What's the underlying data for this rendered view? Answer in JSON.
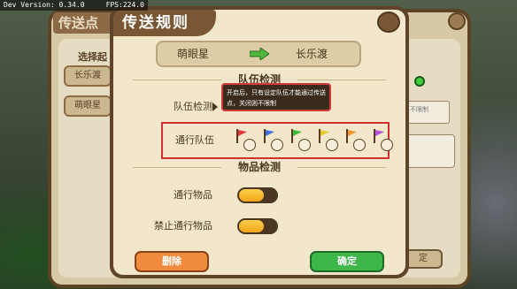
{
  "debug": {
    "text": "Dev Version: 0.34.0     FPS:224.0"
  },
  "back_panel": {
    "title": "传送点",
    "subtitle": "选择起",
    "tab_1": "长乐渡",
    "tab_2": "萌眼星",
    "field_text": "不限制",
    "button": "定"
  },
  "dialog": {
    "title": "传送规则",
    "route": {
      "from": "萌眼星",
      "to": "长乐渡"
    },
    "team_section": {
      "header": "队伍检测",
      "team_check_label": "队伍检测",
      "tooltip": "开启后，只有设定队伍才能通过传送点，关闭则不限制",
      "pass_team_label": "通行队伍",
      "teams": [
        {
          "color": "#e2373b",
          "checked": false
        },
        {
          "color": "#3d6fe0",
          "checked": false
        },
        {
          "color": "#3bbf3b",
          "checked": false
        },
        {
          "color": "#e8cc2c",
          "checked": false
        },
        {
          "color": "#f0962a",
          "checked": false
        },
        {
          "color": "#b454d8",
          "checked": false
        }
      ]
    },
    "item_section": {
      "header": "物品检测",
      "pass_item_label": "通行物品",
      "pass_item_on": true,
      "forbid_item_label": "禁止通行物品",
      "forbid_item_on": true
    },
    "delete_label": "删除",
    "confirm_label": "确定"
  },
  "colors": {
    "dialog_bg": "#f2e6cb",
    "frame": "#5f4429",
    "highlight": "#d42f2f",
    "toggle_on": "#f1a51a",
    "confirm": "#3fb64a",
    "delete": "#f08a3c"
  }
}
